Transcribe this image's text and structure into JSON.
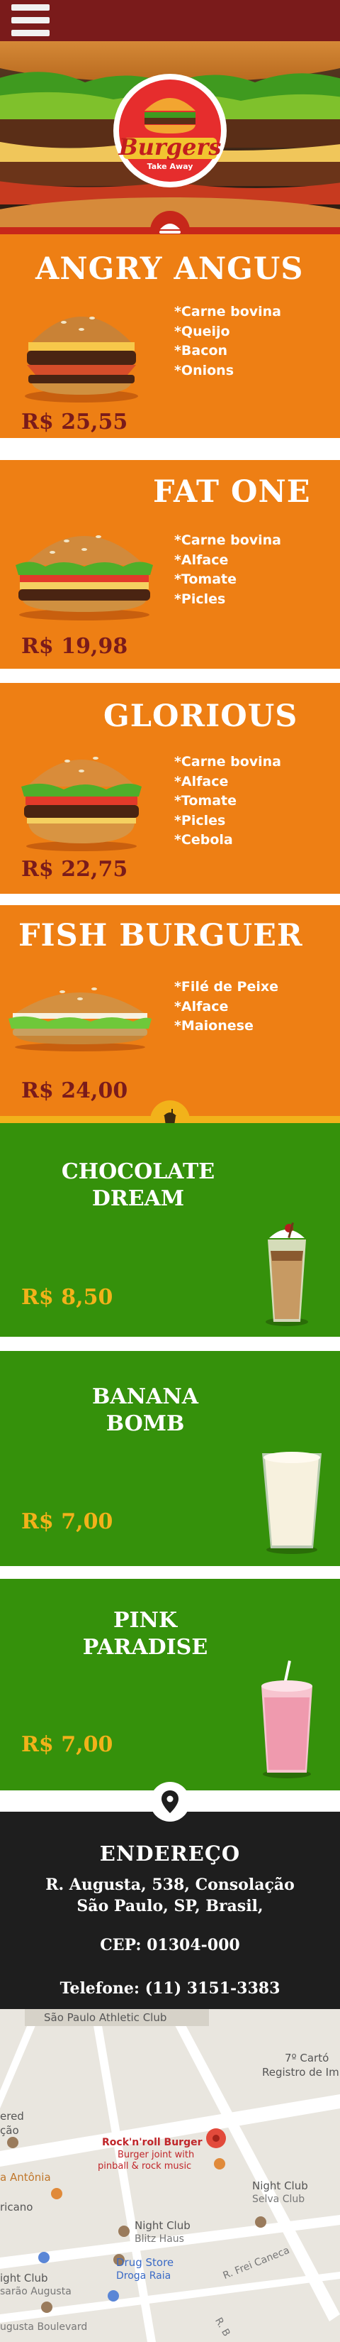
{
  "header": {
    "menu_icon": "hamburger-menu-icon",
    "bg_color": "#7a1b1b"
  },
  "hero": {
    "logo_main": "Burgers",
    "logo_tag": "Take Away"
  },
  "colors": {
    "burger_bg": "#ee7f14",
    "drink_bg": "#35910b",
    "separator_red": "#c7271a",
    "separator_yellow": "#f2b21a",
    "price_burger": "#7a1b1b",
    "price_drink": "#f2b21a",
    "address_bg": "#1e1e1e"
  },
  "burgers": [
    {
      "name": "ANGRY ANGUS",
      "ingredients": [
        "*Carne bovina",
        "*Queijo",
        "*Bacon",
        "*Onions"
      ],
      "price": "R$ 25,55"
    },
    {
      "name": "FAT ONE",
      "ingredients": [
        "*Carne bovina",
        "*Alface",
        "*Tomate",
        "*Picles"
      ],
      "price": "R$ 19,98"
    },
    {
      "name": "GLORIOUS",
      "ingredients": [
        "*Carne bovina",
        "*Alface",
        "*Tomate",
        "*Picles",
        "*Cebola"
      ],
      "price": "R$ 22,75"
    },
    {
      "name": "FISH BURGUER",
      "ingredients": [
        "*Filé de Peixe",
        "*Alface",
        "*Maionese"
      ],
      "price": "R$ 24,00"
    }
  ],
  "drinks": [
    {
      "name_line1": "CHOCOLATE",
      "name_line2": "DREAM",
      "price": "R$ 8,50"
    },
    {
      "name_line1": "BANANA",
      "name_line2": "BOMB",
      "price": "R$ 7,00"
    },
    {
      "name_line1": "PINK",
      "name_line2": "PARADISE",
      "price": "R$ 7,00"
    }
  ],
  "address": {
    "heading": "ENDEREÇO",
    "line1": "R. Augusta, 538, Consolação",
    "line2": "São Paulo, SP, Brasil,",
    "cep": "CEP: 01304-000",
    "phone": "Telefone: (11) 3151-3383"
  },
  "map": {
    "labels": {
      "athletic_club": "São Paulo Athletic Club",
      "cartorio_1": "7º Cartó",
      "cartorio_2": "Registro de Im",
      "red_1": "ered",
      "red_2": "ção",
      "place_title": "Rock'n'roll Burger",
      "place_desc_1": "Burger joint with",
      "place_desc_2": "pinball & rock music",
      "night_club_1": "Night Club",
      "selva_club": "Selva Club",
      "antonia": "a Antônia",
      "ricano": "ricano",
      "night_club_2": "Night Club",
      "blitz_haus": "Blitz Haus",
      "r_frei_caneca": "R. Frei Caneca",
      "drug_store": "Drug Store",
      "droga_raia": "Droga Raia",
      "ight_club": "ight Club",
      "sarao": "sarão Augusta",
      "augusta_blvd": "ugusta Boulevard",
      "rua_b": "R. B"
    }
  }
}
